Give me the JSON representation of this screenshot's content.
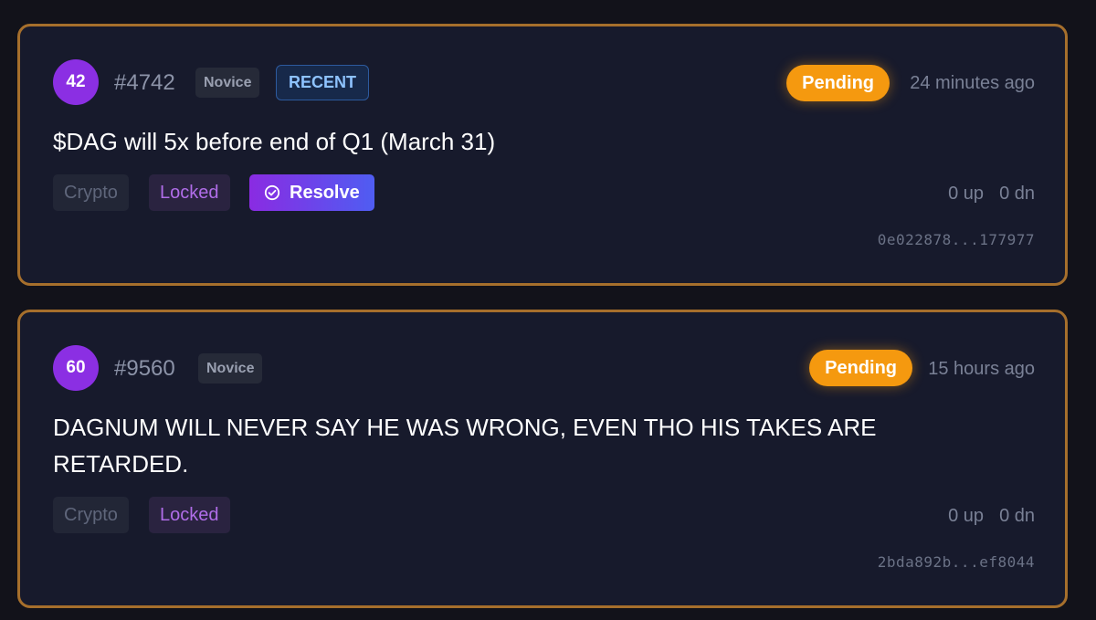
{
  "posts": [
    {
      "avatar_number": "42",
      "id_label": "#4742",
      "rank": "Novice",
      "recent_badge": "RECENT",
      "status": "Pending",
      "time": "24 minutes ago",
      "title": "$DAG will 5x before end of Q1 (March 31)",
      "category": "Crypto",
      "lock_label": "Locked",
      "resolve_label": "Resolve",
      "up_votes": "0 up",
      "down_votes": "0 dn",
      "hash": "0e022878...177977"
    },
    {
      "avatar_number": "60",
      "id_label": "#9560",
      "rank": "Novice",
      "status": "Pending",
      "time": "15 hours ago",
      "title": "DAGNUM WILL NEVER SAY HE WAS WRONG, EVEN THO HIS TAKES ARE RETARDED.",
      "category": "Crypto",
      "lock_label": "Locked",
      "up_votes": "0 up",
      "down_votes": "0 dn",
      "hash": "2bda892b...ef8044"
    }
  ],
  "colors": {
    "background": "#12121a",
    "card_background": "#171a2c",
    "card_border": "#a66f2c",
    "avatar": "#8b2fe3",
    "pending": "#f5990f",
    "recent_text": "#8ec3ff",
    "locked_text": "#b06de8"
  },
  "icons": {
    "resolve": "check-circle-icon"
  }
}
